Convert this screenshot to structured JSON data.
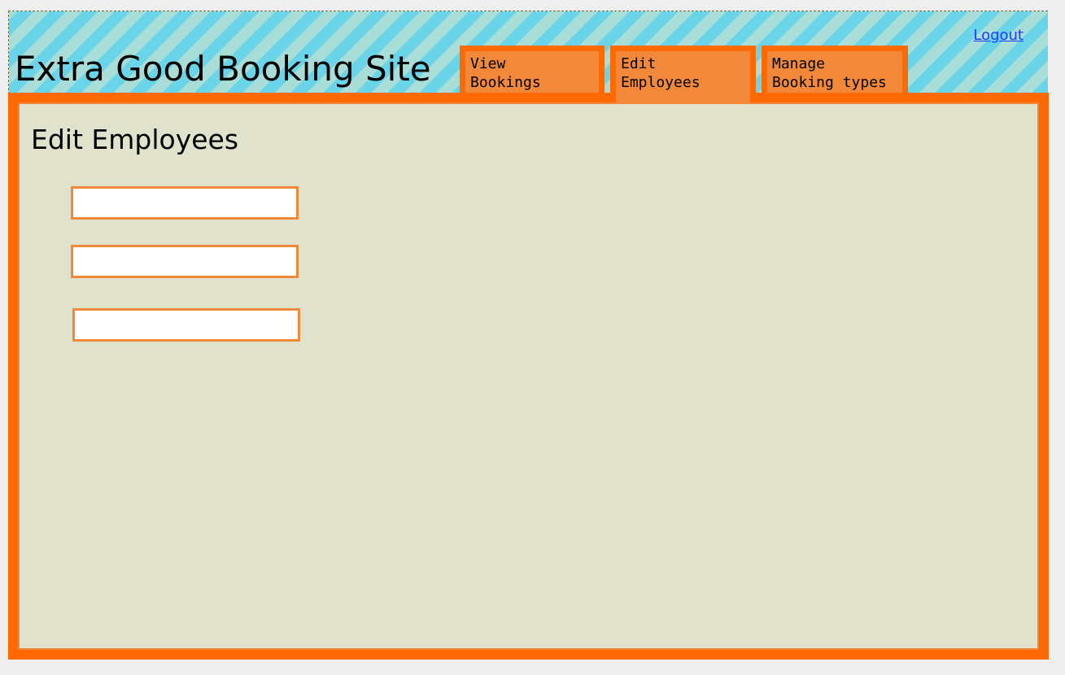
{
  "header": {
    "site_title": "Extra Good Booking Site",
    "logout_label": "Logout"
  },
  "nav": {
    "tabs": [
      {
        "label": "View\nBookings",
        "active": false
      },
      {
        "label": "Edit\nEmployees",
        "active": true
      },
      {
        "label": "Manage\nBooking types",
        "active": false
      }
    ]
  },
  "main": {
    "heading": "Edit Employees",
    "fields": [
      {
        "value": "",
        "placeholder": ""
      },
      {
        "value": "",
        "placeholder": ""
      },
      {
        "value": "",
        "placeholder": ""
      }
    ]
  },
  "colors": {
    "accent_orange": "#ff6a00",
    "tab_orange": "#f2893a",
    "panel_background": "#e0e2cb",
    "header_stripe_blue": "#6ad5e9",
    "header_stripe_light": "#a8ddd8",
    "link_blue": "#1a3cff"
  }
}
